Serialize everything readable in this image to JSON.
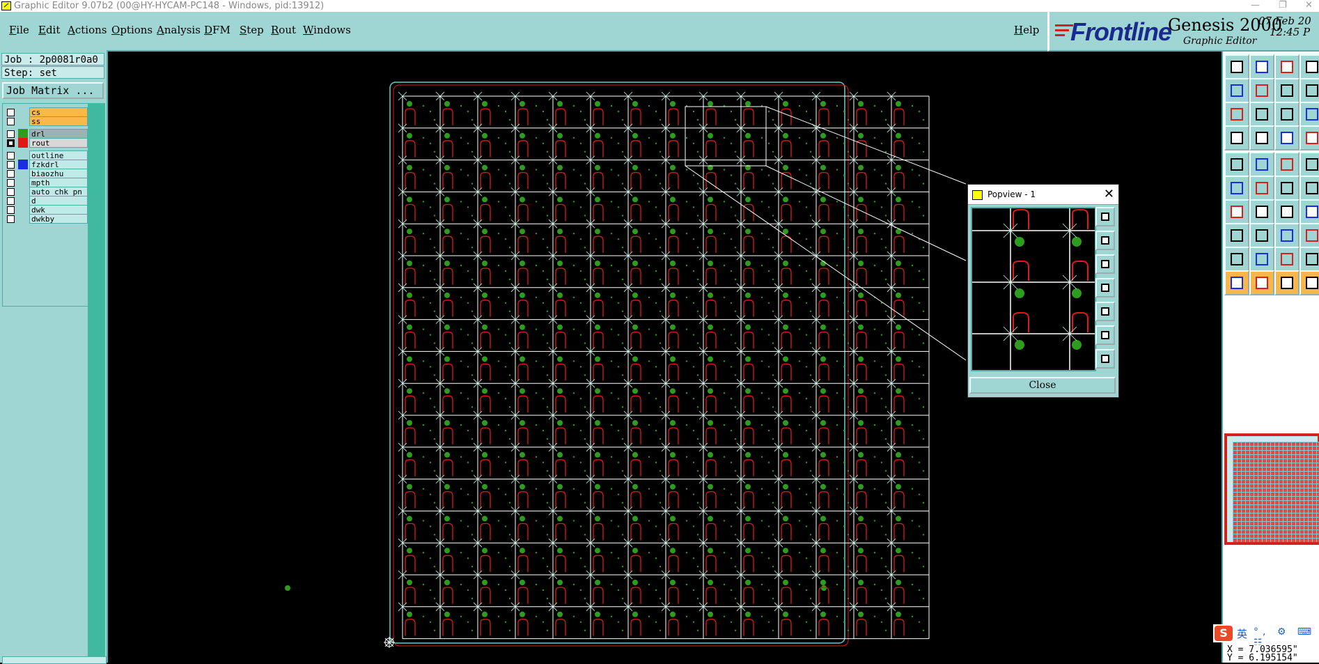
{
  "window": {
    "title": "Graphic Editor 9.07b2 (00@HY-HYCAM-PC148 - Windows, pid:13912)",
    "minimize": "—",
    "restore": "❐",
    "close": "✕"
  },
  "menu": [
    "File",
    "Edit",
    "Actions",
    "Options",
    "Analysis",
    "DFM",
    "Step",
    "Rout",
    "Windows"
  ],
  "help_label": "Help",
  "brand": {
    "company": "Frontline",
    "product": "Genesis 2000",
    "module": "Graphic Editor",
    "date": "07 Feb 20",
    "time": "12:45 P"
  },
  "job": {
    "job_label": "Job : 2p0081r0a0",
    "step_label": "Step: set",
    "matrix_button": "Job Matrix ..."
  },
  "layers": [
    {
      "name": "cs",
      "group": "board",
      "checked": false,
      "color": ""
    },
    {
      "name": "ss",
      "group": "board",
      "checked": false,
      "color": ""
    },
    {
      "name": "drl",
      "group": "drill",
      "checked": false,
      "color": "#2e9c1f"
    },
    {
      "name": "rout",
      "group": "rout",
      "checked": true,
      "color": "#e01818"
    },
    {
      "name": "outline",
      "group": "misc",
      "checked": false,
      "color": ""
    },
    {
      "name": "fzkdrl",
      "group": "misc",
      "checked": false,
      "color": "#1a2ee0"
    },
    {
      "name": "biaozhu",
      "group": "misc",
      "checked": false,
      "color": ""
    },
    {
      "name": "mpth",
      "group": "misc",
      "checked": false,
      "color": ""
    },
    {
      "name": "auto_chk_pn",
      "group": "misc",
      "checked": false,
      "color": ""
    },
    {
      "name": "d",
      "group": "misc",
      "checked": false,
      "color": ""
    },
    {
      "name": "dwk",
      "group": "misc",
      "checked": false,
      "color": ""
    },
    {
      "name": "dwkby",
      "group": "misc",
      "checked": false,
      "color": ""
    }
  ],
  "popview": {
    "title": "Popview - 1",
    "close_icon": "✕",
    "close_button": "Close"
  },
  "status": {
    "coords": "X = 7.036595\"\nY = 6.195154\""
  },
  "colors": {
    "panel": "#9fd6d4",
    "drill_pad": "#2e9c1f",
    "rout_line": "#e01818",
    "grid_line": "#ffffff",
    "panel_border": "#5fd0c8"
  },
  "ime": {
    "logo": "S",
    "lang": "英",
    "icons": "°, ⚙ ⌨ ☷"
  }
}
